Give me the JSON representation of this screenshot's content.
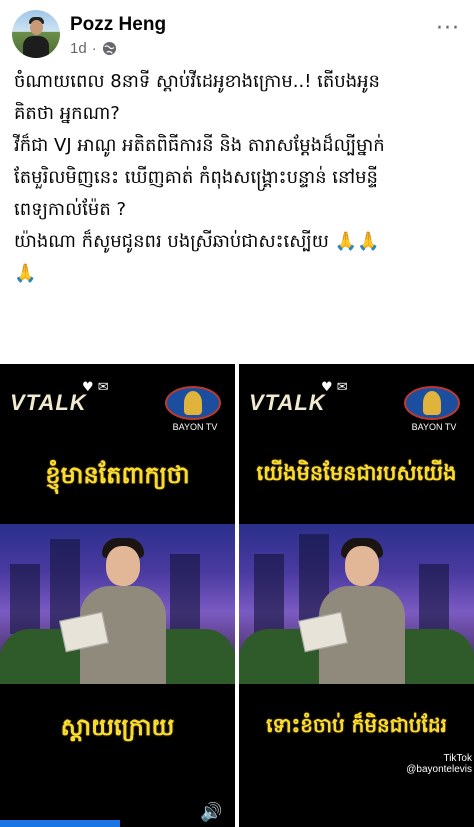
{
  "post": {
    "author": "Pozz Heng",
    "time": "1d",
    "dot": "·",
    "menu": "···",
    "lines": [
      "ចំណាយពេល 8នាទី ស្ដាប់វីដេអូខាងក្រោម..! តើបងអូន",
      "គិតថា អ្នកណា?",
      "វីក៏ជា VJ អាណូ អតិតពិធីការនី និង តារាសម្ដែងដ៏ល្បីម្នាក់",
      "តែមួរិលមិញនេះ ឃើញគាត់ កំពុងសង្គ្រោះបន្ទាន់ នៅមន្ទី",
      "ពេទ្យកាល់ម៉ែត ?",
      "យ៉ាងណា ក៏សូមជូនពរ បងស្រីឆាប់ជាសះស្បើយ 🙏🙏",
      "🙏"
    ]
  },
  "media": {
    "left": {
      "show": "VTALK",
      "channel": "BAYON TV",
      "caption_top": "ខ្ញុំមានតែពាក្យថា",
      "caption_bottom": "ស្ដាយក្រោយ",
      "tiktok_handle": ""
    },
    "right": {
      "show": "VTALK",
      "channel": "BAYON TV",
      "caption_top": "យើងមិនមែនជារបស់យើង",
      "caption_bottom": "ទោះខំចាប់ ក៏មិនជាប់ដែរ",
      "tiktok_label": "TikTok",
      "tiktok_handle": "@bayontelevis"
    },
    "sound_icon": "speaker-icon",
    "colors": {
      "caption": "#f8dc2f",
      "accent": "#1b74e4"
    }
  }
}
